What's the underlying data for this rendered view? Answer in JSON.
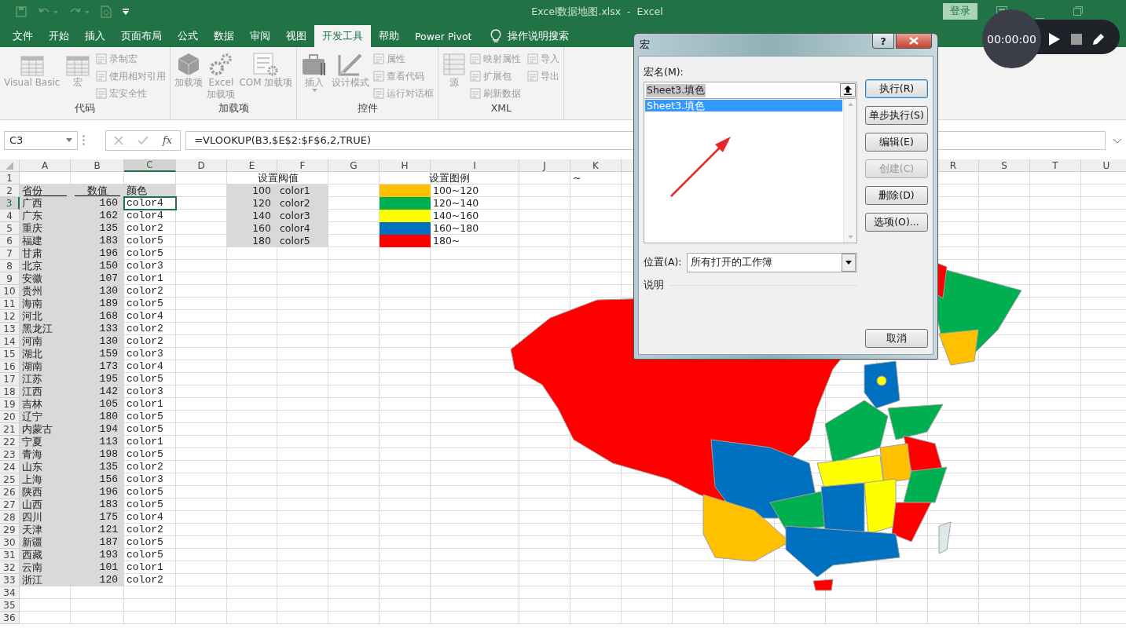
{
  "title_bar": {
    "title": "Excel数据地图.xlsx  -  Excel",
    "sign_in": "登录"
  },
  "recorder": {
    "time": "00:00:00"
  },
  "tabs": [
    {
      "label": "文件",
      "selected": false
    },
    {
      "label": "开始",
      "selected": false
    },
    {
      "label": "插入",
      "selected": false
    },
    {
      "label": "页面布局",
      "selected": false
    },
    {
      "label": "公式",
      "selected": false
    },
    {
      "label": "数据",
      "selected": false
    },
    {
      "label": "审阅",
      "selected": false
    },
    {
      "label": "视图",
      "selected": false
    },
    {
      "label": "开发工具",
      "selected": true
    },
    {
      "label": "帮助",
      "selected": false
    },
    {
      "label": "Power Pivot",
      "selected": false
    }
  ],
  "tell_me": "操作说明搜索",
  "ribbon": {
    "groups": [
      {
        "label": "代码",
        "large": [
          {
            "label": "Visual Basic",
            "disabled": true
          },
          {
            "label": "宏",
            "disabled": true
          }
        ],
        "small": [
          {
            "label": "录制宏",
            "disabled": true
          },
          {
            "label": "使用相对引用",
            "disabled": true
          },
          {
            "label": "宏安全性",
            "disabled": true
          }
        ]
      },
      {
        "label": "加载项",
        "large": [
          {
            "label": "加载项",
            "disabled": true
          },
          {
            "label": "Excel\n加载项",
            "disabled": true
          },
          {
            "label": "COM 加载项",
            "disabled": true
          }
        ]
      },
      {
        "label": "控件",
        "large": [
          {
            "label": "插入",
            "disabled": true,
            "dropdown": true
          },
          {
            "label": "设计模式",
            "disabled": true
          }
        ],
        "small": [
          {
            "label": "属性",
            "disabled": true
          },
          {
            "label": "查看代码",
            "disabled": true
          },
          {
            "label": "运行对话框",
            "disabled": true
          }
        ]
      },
      {
        "label": "XML",
        "large": [
          {
            "label": "源",
            "disabled": true
          }
        ],
        "small": [
          {
            "label": "映射属性",
            "disabled": true
          },
          {
            "label": "扩展包",
            "disabled": true
          },
          {
            "label": "刷新数据",
            "disabled": true
          },
          {
            "label": "导入",
            "disabled": true
          },
          {
            "label": "导出",
            "disabled": true
          }
        ]
      }
    ]
  },
  "formula_bar": {
    "name_box": "C3",
    "fx": "fx",
    "formula": "=VLOOKUP(B3,$E$2:$F$6,2,TRUE)"
  },
  "sheet": {
    "columns": [
      "A",
      "B",
      "C",
      "D",
      "E",
      "F",
      "G",
      "H",
      "I",
      "J",
      "K"
    ],
    "columns_right": [
      "R",
      "S",
      "T",
      "U"
    ],
    "row_numbers": [
      "1",
      "2",
      "3",
      "4",
      "5",
      "6",
      "7",
      "8",
      "9",
      "10",
      "11",
      "12",
      "13",
      "14",
      "15",
      "16",
      "17",
      "18",
      "19",
      "20",
      "21",
      "22",
      "23",
      "24",
      "25",
      "26",
      "27",
      "28",
      "29",
      "30",
      "31",
      "32",
      "33",
      "34",
      "35",
      "36"
    ],
    "k1_note": "~"
  },
  "provinces": {
    "header": {
      "province": "省份",
      "value": "数值",
      "color_code": "颜色"
    },
    "rows": [
      {
        "province": "广西",
        "value": "160",
        "color_code": "color4",
        "selected": true
      },
      {
        "province": "广东",
        "value": "162",
        "color_code": "color4",
        "selected": false
      },
      {
        "province": "重庆",
        "value": "135",
        "color_code": "color2",
        "selected": false
      },
      {
        "province": "福建",
        "value": "183",
        "color_code": "color5",
        "selected": false
      },
      {
        "province": "甘肃",
        "value": "196",
        "color_code": "color5",
        "selected": false
      },
      {
        "province": "北京",
        "value": "150",
        "color_code": "color3",
        "selected": false
      },
      {
        "province": "安徽",
        "value": "107",
        "color_code": "color1",
        "selected": false
      },
      {
        "province": "贵州",
        "value": "130",
        "color_code": "color2",
        "selected": false
      },
      {
        "province": "海南",
        "value": "189",
        "color_code": "color5",
        "selected": false
      },
      {
        "province": "河北",
        "value": "168",
        "color_code": "color4",
        "selected": false
      },
      {
        "province": "黑龙江",
        "value": "133",
        "color_code": "color2",
        "selected": false
      },
      {
        "province": "河南",
        "value": "130",
        "color_code": "color2",
        "selected": false
      },
      {
        "province": "湖北",
        "value": "159",
        "color_code": "color3",
        "selected": false
      },
      {
        "province": "湖南",
        "value": "173",
        "color_code": "color4",
        "selected": false
      },
      {
        "province": "江苏",
        "value": "195",
        "color_code": "color5",
        "selected": false
      },
      {
        "province": "江西",
        "value": "142",
        "color_code": "color3",
        "selected": false
      },
      {
        "province": "吉林",
        "value": "105",
        "color_code": "color1",
        "selected": false
      },
      {
        "province": "辽宁",
        "value": "180",
        "color_code": "color5",
        "selected": false
      },
      {
        "province": "内蒙古",
        "value": "194",
        "color_code": "color5",
        "selected": false
      },
      {
        "province": "宁夏",
        "value": "113",
        "color_code": "color1",
        "selected": false
      },
      {
        "province": "青海",
        "value": "198",
        "color_code": "color5",
        "selected": false
      },
      {
        "province": "山东",
        "value": "135",
        "color_code": "color2",
        "selected": false
      },
      {
        "province": "上海",
        "value": "156",
        "color_code": "color3",
        "selected": false
      },
      {
        "province": "陕西",
        "value": "196",
        "color_code": "color5",
        "selected": false
      },
      {
        "province": "山西",
        "value": "183",
        "color_code": "color5",
        "selected": false
      },
      {
        "province": "四川",
        "value": "175",
        "color_code": "color4",
        "selected": false
      },
      {
        "province": "天津",
        "value": "121",
        "color_code": "color2",
        "selected": false
      },
      {
        "province": "新疆",
        "value": "187",
        "color_code": "color5",
        "selected": false
      },
      {
        "province": "西藏",
        "value": "193",
        "color_code": "color5",
        "selected": false
      },
      {
        "province": "云南",
        "value": "101",
        "color_code": "color1",
        "selected": false
      },
      {
        "province": "浙江",
        "value": "120",
        "color_code": "color2",
        "selected": false
      }
    ]
  },
  "thresholds": {
    "title": "设置阀值",
    "rows": [
      {
        "value": "100",
        "color_code": "color1"
      },
      {
        "value": "120",
        "color_code": "color2"
      },
      {
        "value": "140",
        "color_code": "color3"
      },
      {
        "value": "160",
        "color_code": "color4"
      },
      {
        "value": "180",
        "color_code": "color5"
      }
    ]
  },
  "legend": {
    "title": "设置图例",
    "items": [
      {
        "color": "#ffc000",
        "range": "100~120"
      },
      {
        "color": "#00b050",
        "range": "120~140"
      },
      {
        "color": "#ffff00",
        "range": "140~160"
      },
      {
        "color": "#0070c0",
        "range": "160~180"
      },
      {
        "color": "#ff0000",
        "range": "180~"
      }
    ]
  },
  "dialog": {
    "title": "宏",
    "help": "?",
    "name_label": "宏名(M):",
    "name_value": "Sheet3.填色",
    "macros": [
      {
        "name": "Sheet3.填色",
        "selected": true
      }
    ],
    "buttons": [
      {
        "label": "执行(R)",
        "default": true,
        "disabled": false
      },
      {
        "label": "单步执行(S)",
        "default": false,
        "disabled": false
      },
      {
        "label": "编辑(E)",
        "default": false,
        "disabled": false
      },
      {
        "label": "创建(C)",
        "default": false,
        "disabled": true
      },
      {
        "label": "删除(D)",
        "default": false,
        "disabled": false
      },
      {
        "label": "选项(O)...",
        "default": false,
        "disabled": false
      }
    ],
    "location_label": "位置(A):",
    "location_value": "所有打开的工作簿",
    "description_label": "说明",
    "cancel": "取消"
  }
}
